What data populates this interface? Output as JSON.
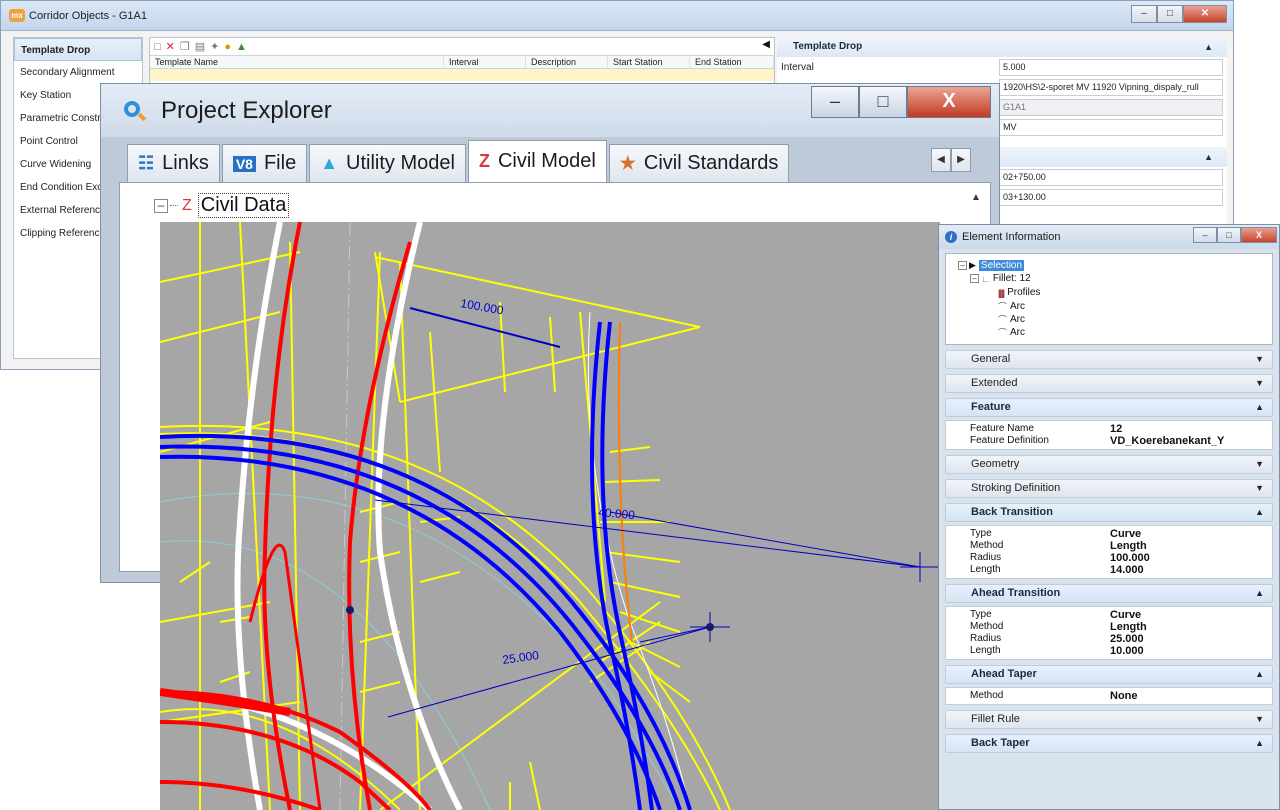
{
  "corridor": {
    "title": "Corridor Objects - G1A1",
    "logo": "mx",
    "left_items": [
      "Template Drop",
      "Secondary Alignment",
      "Key Station",
      "Parametric Constrai",
      "Point Control",
      "Curve Widening",
      "End Condition Excep",
      "External Reference",
      "Clipping Reference"
    ],
    "columns": [
      "Template Name",
      "Interval",
      "Description",
      "Start Station",
      "End Station"
    ],
    "section_title": "Template Drop",
    "interval_label": "Interval",
    "interval_value": "5.000",
    "template_path": "1920\\HS\\2-sporet MV 11920 Vipning_dispaly_rull",
    "field_g1a1": "G1A1",
    "field_mv": "MV",
    "start_station": "02+750.00",
    "end_station": "03+130.00",
    "colors": {
      "title_grad": "#c4d6ec",
      "row_highlight": "#fff3c8"
    }
  },
  "project_explorer": {
    "title": "Project Explorer",
    "tabs": [
      {
        "label": "Links",
        "icon": "links-icon"
      },
      {
        "label": "File",
        "icon": "v8-file-icon"
      },
      {
        "label": "Utility Model",
        "icon": "utility-model-icon"
      },
      {
        "label": "Civil Model",
        "icon": "civil-model-icon"
      },
      {
        "label": "Civil Standards",
        "icon": "civil-standards-icon"
      }
    ],
    "tree_root": "Civil Data"
  },
  "cad": {
    "dim_labels": [
      "100.000",
      "40.000",
      "25.000"
    ],
    "background": "#a6a6a6"
  },
  "element_info": {
    "title": "Element Information",
    "tree": {
      "selection": "Selection",
      "fillet": "Fillet: 12",
      "profiles": "Profiles",
      "arcs": [
        "Arc",
        "Arc",
        "Arc"
      ]
    },
    "sections": {
      "general": "General",
      "extended": "Extended",
      "feature": "Feature",
      "geometry": "Geometry",
      "stroking": "Stroking Definition",
      "back_transition": "Back Transition",
      "ahead_transition": "Ahead Transition",
      "ahead_taper": "Ahead Taper",
      "fillet_rule": "Fillet Rule",
      "back_taper": "Back Taper"
    },
    "feature": [
      {
        "k": "Feature Name",
        "v": "12"
      },
      {
        "k": "Feature Definition",
        "v": "VD_Koerebanekant_Y"
      }
    ],
    "back_transition": [
      {
        "k": "Type",
        "v": "Curve"
      },
      {
        "k": "Method",
        "v": "Length"
      },
      {
        "k": "Radius",
        "v": "100.000"
      },
      {
        "k": "Length",
        "v": "14.000"
      }
    ],
    "ahead_transition": [
      {
        "k": "Type",
        "v": "Curve"
      },
      {
        "k": "Method",
        "v": "Length"
      },
      {
        "k": "Radius",
        "v": "25.000"
      },
      {
        "k": "Length",
        "v": "10.000"
      }
    ],
    "ahead_taper": [
      {
        "k": "Method",
        "v": "None"
      }
    ]
  }
}
